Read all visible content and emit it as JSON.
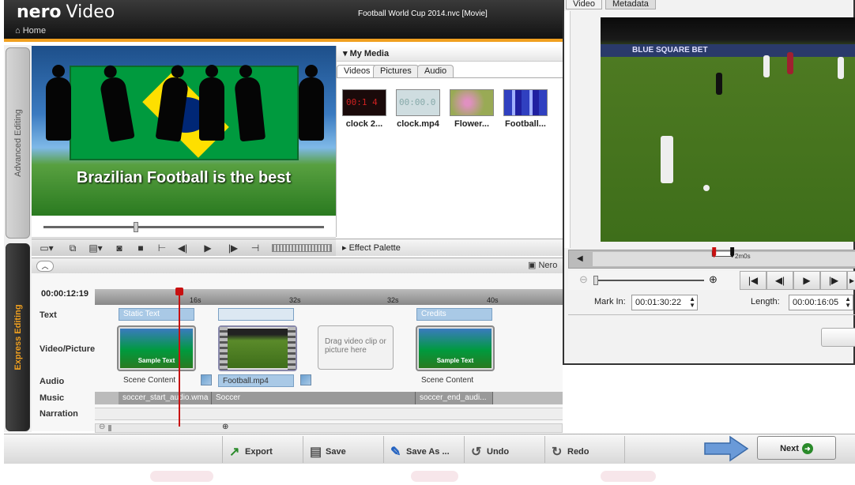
{
  "app": {
    "logo": "nero",
    "product": "Video",
    "home": "Home",
    "project_title": "Football World Cup 2014.nvc [Movie]"
  },
  "sidebar": {
    "tabs": [
      "Advanced Editing",
      "Express Editing"
    ]
  },
  "preview": {
    "caption": "Brazilian Football is the best",
    "progress": 0.32
  },
  "media": {
    "title": "My Media",
    "tabs": [
      "Videos",
      "Pictures",
      "Audio"
    ],
    "items": [
      {
        "label": "clock 2...",
        "color": "#1a0a0a"
      },
      {
        "label": "clock.mp4",
        "color": "#cfdde0"
      },
      {
        "label": "Flower...",
        "color": "#c070a0"
      },
      {
        "label": "Football...",
        "color": "#3040c0"
      }
    ]
  },
  "effect_palette": {
    "title": "Effect Palette"
  },
  "timeline": {
    "nero_label": "Nero",
    "timecode": "00:00:12:19",
    "ticks": [
      "16s",
      "32s",
      "32s",
      "40s"
    ],
    "rows": [
      "Text",
      "Video/Picture",
      "Audio",
      "Music",
      "Narration"
    ],
    "text_clips": [
      "Static Text",
      "",
      "Credits"
    ],
    "video_clip_captions": [
      "Sample Text",
      "Sample Text"
    ],
    "dropzone": "Drag video clip or picture here",
    "audio_labels": [
      "Scene Content",
      "Football.mp4",
      "Scene Content"
    ],
    "music_clips": [
      "soccer_start_audio.wma",
      "Soccer",
      "soccer_end_audi..."
    ]
  },
  "toolbar": {
    "export": "Export",
    "save": "Save",
    "save_as": "Save As ...",
    "undo": "Undo",
    "redo": "Redo",
    "next": "Next"
  },
  "dialog": {
    "tabs": [
      "Video",
      "Metadata"
    ],
    "banner": "BLUE SQUARE BET",
    "timestamp": "2m0s",
    "mark_in_label": "Mark In:",
    "mark_in": "00:01:30:22",
    "length_label": "Length:",
    "length": "00:00:16:05"
  },
  "colors": {
    "accent": "#f0a020",
    "playhead": "#c81010",
    "clip_blue": "#a9c9e6"
  }
}
